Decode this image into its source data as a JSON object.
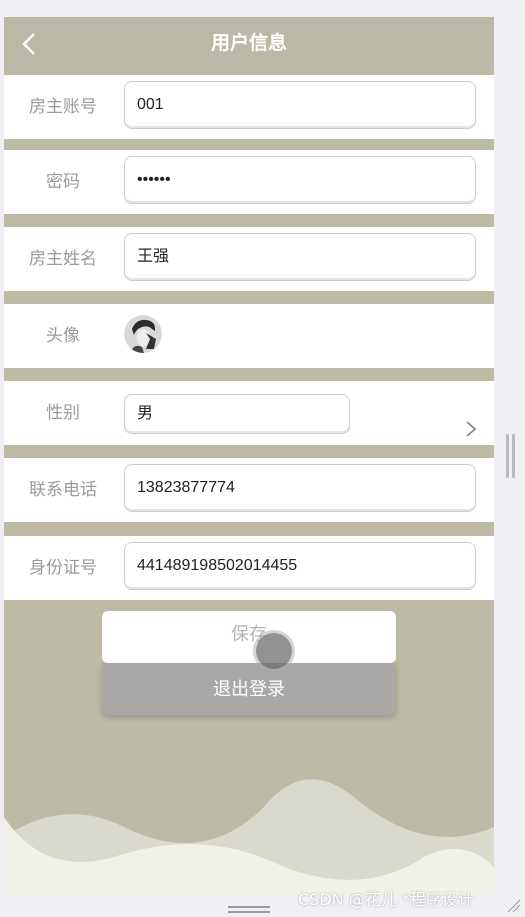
{
  "header": {
    "title": "用户信息",
    "back_icon": "chevron-left-icon"
  },
  "form": {
    "account": {
      "label": "房主账号",
      "value": "001"
    },
    "password": {
      "label": "密码",
      "value": "••••••"
    },
    "name": {
      "label": "房主姓名",
      "value": "王强"
    },
    "avatar": {
      "label": "头像"
    },
    "gender": {
      "label": "性别",
      "value": "男"
    },
    "phone": {
      "label": "联系电话",
      "value": "13823877774"
    },
    "id_card": {
      "label": "身份证号",
      "value": "441489198502014455"
    }
  },
  "buttons": {
    "save": "保存",
    "logout": "退出登录"
  },
  "watermark": "CSDN @花儿 *程序设计",
  "colors": {
    "theme": "#bdbba6",
    "header": "#bbb9a5",
    "logout_bg": "#a9a8a6"
  }
}
